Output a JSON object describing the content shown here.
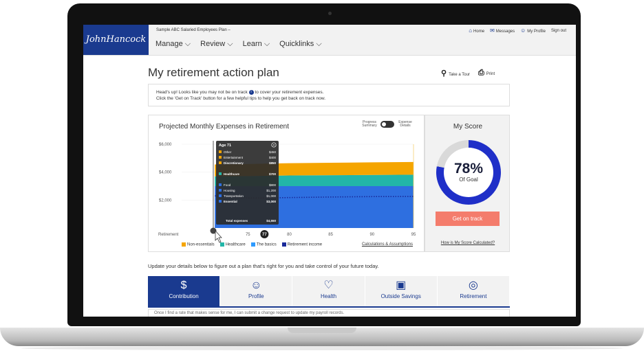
{
  "header": {
    "logo": "JohnHancock",
    "plan_name": "Sample ABC Salaried Employees Plan  –",
    "nav": [
      "Manage ⌵",
      "Review ⌵",
      "Learn ⌵",
      "Quicklinks ⌵"
    ],
    "util": {
      "home": "Home",
      "messages": "Messages",
      "profile": "My Profile",
      "signout": "Sign out"
    }
  },
  "page": {
    "title": "My retirement action plan",
    "take_tour": "Take a Tour",
    "print": "Print"
  },
  "alert": {
    "line1_a": "Head's up! Looks like you may not be on track",
    "line1_b": "to cover your retirement expenses.",
    "line2": "Click the 'Get on Track' button for a few helpful tips to help you get back on track now."
  },
  "chart_panel": {
    "title": "Projected Monthly Expenses in Retirement",
    "toggle_left": "Progress Summary",
    "toggle_right": "Expense Details",
    "calc_link": "Calculations & Assumptions"
  },
  "chart_data": {
    "type": "area",
    "ylabels": [
      "$6,000",
      "$4,000",
      "$2,000"
    ],
    "yticks": [
      6000,
      4000,
      2000
    ],
    "ylim": [
      0,
      6000
    ],
    "x_labels": [
      "Retirement",
      "75",
      "77",
      "80",
      "85",
      "90",
      "95"
    ],
    "x": [
      71,
      75,
      77,
      80,
      85,
      90,
      95
    ],
    "xlim": [
      67,
      95
    ],
    "series": [
      {
        "name": "The basics",
        "color": "#2e6fe0",
        "values": [
          3000,
          3000,
          3000,
          3000,
          3000,
          3000,
          3000
        ]
      },
      {
        "name": "Healthcare",
        "color": "#22b6a8",
        "values": [
          700,
          720,
          740,
          760,
          780,
          800,
          820
        ]
      },
      {
        "name": "Non-essentials",
        "color": "#f5a500",
        "values": [
          850,
          860,
          870,
          880,
          890,
          900,
          910
        ]
      }
    ],
    "retirement_income": {
      "name": "Retirement income",
      "color": "#1a2a9a",
      "values": [
        2300,
        2150,
        2150,
        2180,
        2220,
        2250,
        2260
      ]
    },
    "tooltip": {
      "title": "Age 71",
      "rows": [
        {
          "label": "Other",
          "value": "$450",
          "color": "#f5a500"
        },
        {
          "label": "Entertainment",
          "value": "$400",
          "color": "#f5a500"
        },
        {
          "label": "Discretionary",
          "value": "$850",
          "color": "#f5a500",
          "bold": true
        },
        {
          "label": "Healthcare",
          "value": "$700",
          "color": "#22b6a8",
          "bold": true
        },
        {
          "label": "Food",
          "value": "$800",
          "color": "#2e6fe0"
        },
        {
          "label": "Housing",
          "value": "$1,200",
          "color": "#2e6fe0"
        },
        {
          "label": "Transportation",
          "value": "$1,000",
          "color": "#2e6fe0"
        },
        {
          "label": "Essential",
          "value": "$3,000",
          "color": "#2e6fe0",
          "bold": true
        }
      ],
      "total_label": "Total expenses",
      "total_value": "$4,550"
    }
  },
  "legend": [
    {
      "label": "Non-essentials",
      "color": "#f5a500"
    },
    {
      "label": "Healthcare",
      "color": "#22b6a8"
    },
    {
      "label": "The basics",
      "color": "#2e9bff"
    },
    {
      "label": "Retirement income",
      "color": "#1a2a9a"
    }
  ],
  "score": {
    "title": "My Score",
    "percent": "78%",
    "percent_value": 78,
    "subtitle": "Of Goal",
    "button": "Get on track",
    "link": "How is My Score Calculated?"
  },
  "update_text": "Update your details below to figure out a plan that's right for you and take control of your future today.",
  "tabs": [
    {
      "label": "Contribution",
      "icon": "dollar-icon",
      "glyph": "$"
    },
    {
      "label": "Profile",
      "icon": "user-icon",
      "glyph": "☺"
    },
    {
      "label": "Health",
      "icon": "heart-icon",
      "glyph": "♡"
    },
    {
      "label": "Outside Savings",
      "icon": "safe-icon",
      "glyph": "▣"
    },
    {
      "label": "Retirement",
      "icon": "target-icon",
      "glyph": "◎"
    }
  ],
  "below_text": "Once I find a rate that makes sense for me, I can submit a change request to update my payroll records."
}
